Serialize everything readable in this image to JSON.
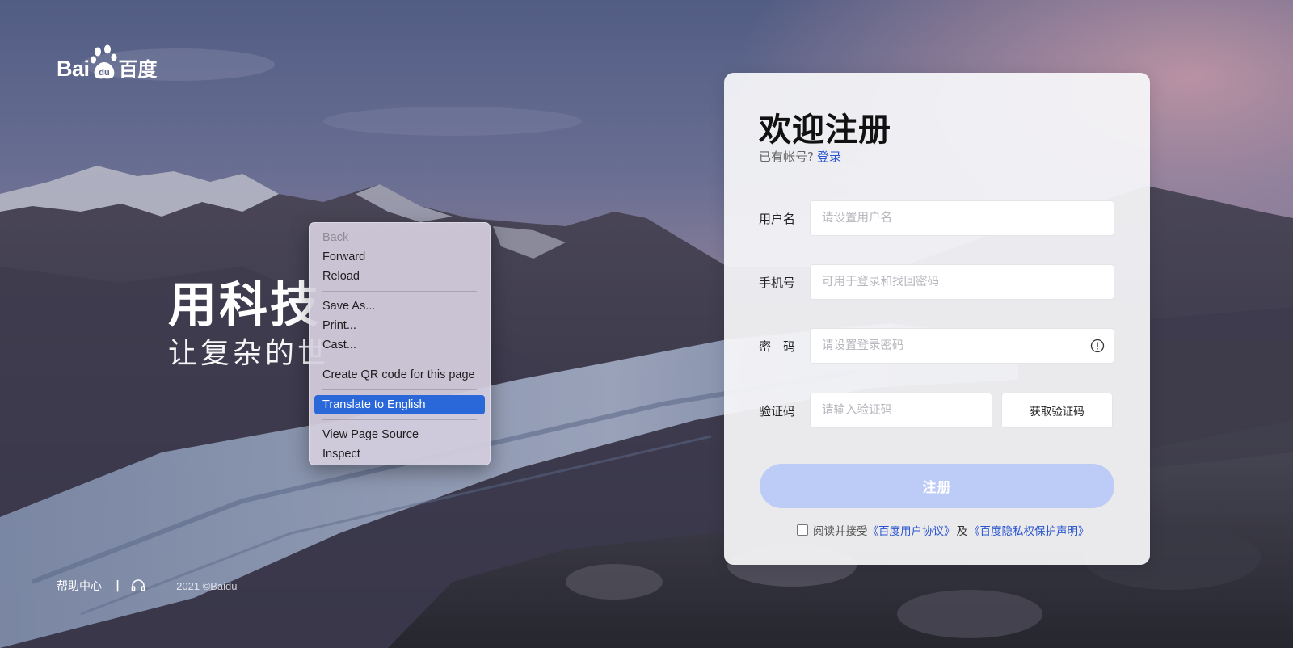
{
  "logo": {
    "latin_prefix": "Bai",
    "paw_text": "du",
    "chinese": "百度"
  },
  "slogan": {
    "line1": "用科技",
    "line2": "让复杂的世"
  },
  "footer": {
    "help": "帮助中心",
    "separator": "|",
    "copyright": "2021 ©Baidu"
  },
  "context_menu": {
    "items": [
      {
        "label": "Back",
        "state": "disabled"
      },
      {
        "label": "Forward"
      },
      {
        "label": "Reload"
      },
      {
        "label": "Save As..."
      },
      {
        "label": "Print..."
      },
      {
        "label": "Cast..."
      },
      {
        "label": "Create QR code for this page"
      },
      {
        "label": "Translate to English",
        "state": "highlighted"
      },
      {
        "label": "View Page Source"
      },
      {
        "label": "Inspect"
      }
    ]
  },
  "register": {
    "title": "欢迎注册",
    "have_account": "已有帐号?",
    "login_link": "登录",
    "fields": {
      "username": {
        "label": "用户名",
        "placeholder": "请设置用户名",
        "value": ""
      },
      "phone": {
        "label": "手机号",
        "placeholder": "可用于登录和找回密码",
        "value": ""
      },
      "password": {
        "label": "密　码",
        "placeholder": "请设置登录密码",
        "value": ""
      },
      "code": {
        "label": "验证码",
        "placeholder": "请输入验证码",
        "value": ""
      }
    },
    "get_code_button": "获取验证码",
    "submit_button": "注册",
    "agree_prefix": "阅读并接受",
    "user_agreement": "《百度用户协议》",
    "and": "及",
    "privacy_statement": "《百度隐私权保护声明》",
    "agreement_checked": false
  },
  "colors": {
    "link": "#2c56cf",
    "submit_disabled": "#bdcbf7",
    "menu_highlight": "#2a67d8"
  }
}
